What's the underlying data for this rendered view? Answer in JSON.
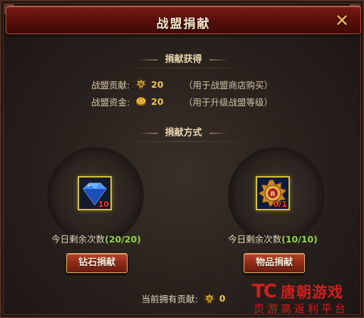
{
  "window": {
    "title": "战盟捐献",
    "close_icon": "close-x-icon"
  },
  "rewards_section": {
    "heading": "捐献获得",
    "items": [
      {
        "label": "战盟贡献:",
        "icon": "contribution-badge-icon",
        "value": "20",
        "note": "（用于战盟商店购买）"
      },
      {
        "label": "战盟资金:",
        "icon": "gold-coin-icon",
        "value": "20",
        "note": "（用于升级战盟等级）"
      }
    ]
  },
  "methods_section": {
    "heading": "捐献方式",
    "methods": [
      {
        "item_icon": "blue-diamond-icon",
        "item_count": "10",
        "remain_label": "今日剩余次数",
        "remain_count": "(20/20)",
        "button_label": "钻石捐献"
      },
      {
        "item_icon": "gold-medal-icon",
        "item_count": "0/1",
        "remain_label": "今日剩余次数",
        "remain_count": "(10/10)",
        "button_label": "物品捐献"
      }
    ]
  },
  "footer": {
    "label": "当前拥有贡献:",
    "icon": "contribution-badge-icon",
    "value": "0"
  },
  "watermark": {
    "logo": "TC",
    "name": "唐朝游戏",
    "slogan": "页游高返利平台"
  },
  "colors": {
    "title_bar": "#5c100c",
    "gold_value": "#f4c64a",
    "green_count": "#8fd44a",
    "red_count": "#ff3a2a",
    "button": "#8e2a18",
    "watermark": "#d21e1e"
  }
}
